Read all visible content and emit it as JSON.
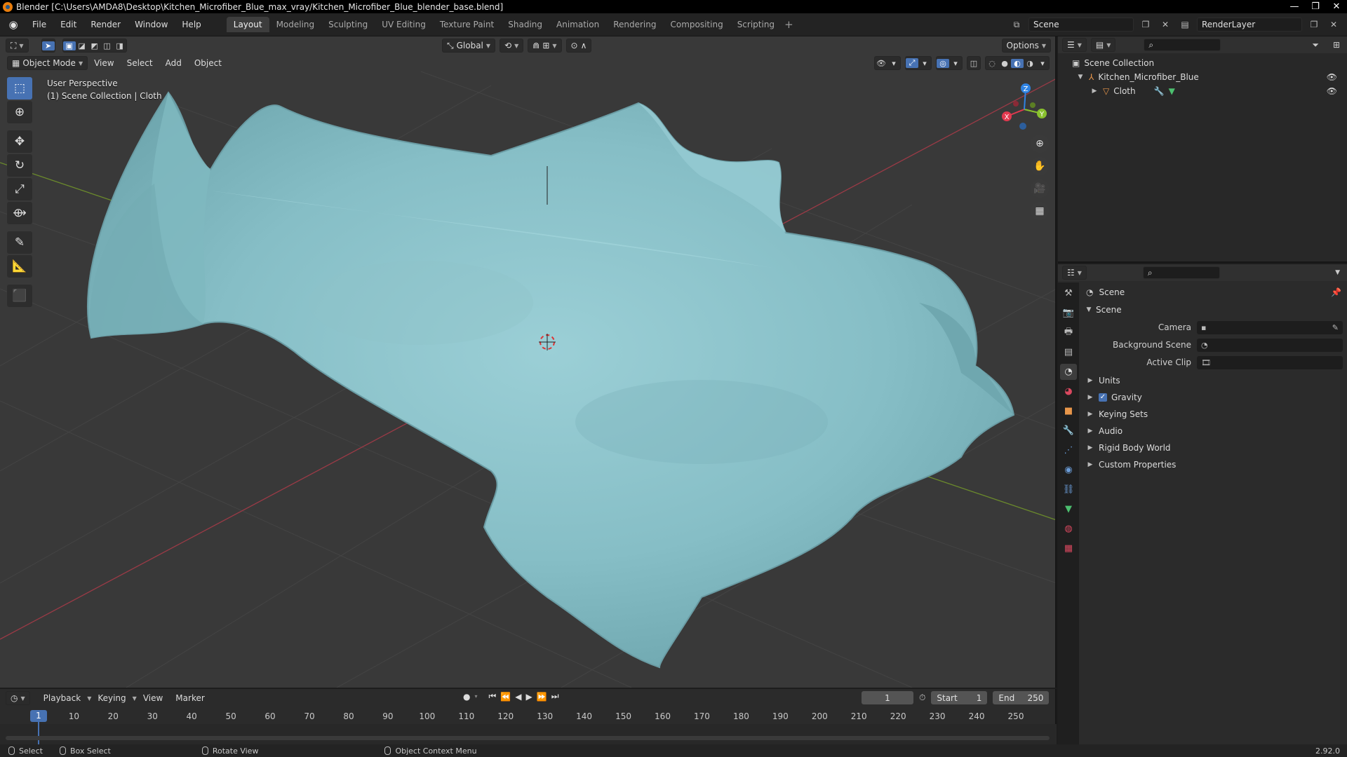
{
  "window": {
    "title": "Blender [C:\\Users\\AMDA8\\Desktop\\Kitchen_Microfiber_Blue_max_vray/Kitchen_Microfiber_Blue_blender_base.blend]",
    "minimize": "—",
    "maximize": "❐",
    "close": "✕"
  },
  "menubar": {
    "menus": [
      "File",
      "Edit",
      "Render",
      "Window",
      "Help"
    ],
    "workspaces": [
      "Layout",
      "Modeling",
      "Sculpting",
      "UV Editing",
      "Texture Paint",
      "Shading",
      "Animation",
      "Rendering",
      "Compositing",
      "Scripting"
    ],
    "active_workspace": "Layout",
    "add_workspace": "+",
    "scene_name": "Scene",
    "view_layer": "RenderLayer"
  },
  "viewport": {
    "mode": "Object Mode",
    "menus": [
      "View",
      "Select",
      "Add",
      "Object"
    ],
    "transform_orientation": "Global",
    "options_label": "Options",
    "info_line1": "User Perspective",
    "info_line2": "(1) Scene Collection | Cloth",
    "gizmo_axes": {
      "x": "X",
      "y": "Y",
      "z": "Z"
    },
    "accent_x": "#e2394f",
    "accent_y": "#89c12e",
    "accent_z": "#2f83e3",
    "cloth_color": "#8ac3cb"
  },
  "toolbar": {
    "tools": [
      "select-box",
      "cursor",
      "move",
      "rotate",
      "scale",
      "transform",
      "annotate",
      "measure",
      "add-cube"
    ]
  },
  "timeline": {
    "menus": [
      "Playback",
      "Keying",
      "View",
      "Marker"
    ],
    "current_frame": "1",
    "start_label": "Start",
    "start_value": "1",
    "end_label": "End",
    "end_value": "250",
    "ruler": [
      "1",
      "10",
      "20",
      "30",
      "40",
      "50",
      "60",
      "70",
      "80",
      "90",
      "100",
      "110",
      "120",
      "130",
      "140",
      "150",
      "160",
      "170",
      "180",
      "190",
      "200",
      "210",
      "220",
      "230",
      "240",
      "250"
    ]
  },
  "statusbar": {
    "select": "Select",
    "box_select": "Box Select",
    "rotate_view": "Rotate View",
    "context_menu": "Object Context Menu",
    "version": "2.92.0"
  },
  "outliner": {
    "root": "Scene Collection",
    "items": [
      {
        "label": "Kitchen_Microfiber_Blue"
      },
      {
        "label": "Cloth"
      }
    ]
  },
  "properties": {
    "context_title": "Scene",
    "panel_title": "Scene",
    "fields": [
      {
        "label": "Camera",
        "value": ""
      },
      {
        "label": "Background Scene",
        "value": ""
      },
      {
        "label": "Active Clip",
        "value": ""
      }
    ],
    "panels": [
      "Units",
      "Gravity",
      "Keying Sets",
      "Audio",
      "Rigid Body World",
      "Custom Properties"
    ],
    "gravity_checked": true
  }
}
